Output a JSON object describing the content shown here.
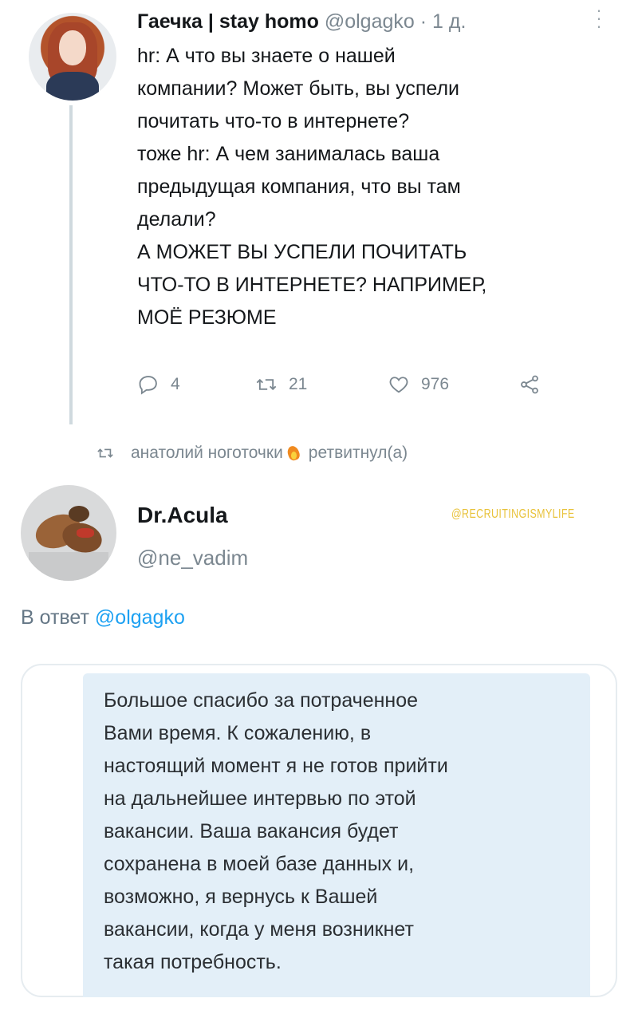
{
  "tweet1": {
    "display_name": "Гаечка | stay homo",
    "handle": "@olgagko",
    "dot": "·",
    "time": "1 д.",
    "body_lines": [
      "hr: А что вы знаете о нашей",
      "компании? Может быть, вы успели",
      "почитать что-то в интернете?",
      "тоже hr: А чем занималась ваша",
      "предыдущая компания, что вы там",
      "делали?",
      "А МОЖЕТ ВЫ УСПЕЛИ ПОЧИТАТЬ",
      "ЧТО-ТО В ИНТЕРНЕТЕ? НАПРИМЕР,",
      "МОЁ РЕЗЮМЕ"
    ],
    "reply_count": "4",
    "retweet_count": "21",
    "like_count": "976",
    "icons": [
      "reply-icon",
      "retweet-icon",
      "like-icon",
      "share-icon",
      "more-icon"
    ]
  },
  "retweet_notice": {
    "user": "анатолий ноготочки",
    "action": "ретвитнул(а)"
  },
  "tweet2": {
    "display_name": "Dr.Acula",
    "handle": "@ne_vadim",
    "watermark": "@RECRUITINGISMYLIFE",
    "reply_to_prefix": "В ответ",
    "reply_to_mention": "@olgagko",
    "quoted_message_lines": [
      "Большое спасибо за потраченное",
      "Вами время. К сожалению, в",
      "настоящий момент я не готов прийти",
      "на дальнейшее интервью по этой",
      "вакансии. Ваша вакансия будет",
      "сохранена в моей базе данных и,",
      "возможно, я вернусь к Вашей",
      "вакансии, когда у меня возникнет",
      "такая потребность."
    ]
  },
  "colors": {
    "link": "#1da1f2",
    "muted": "#7b8790",
    "bubble": "#e3eff8",
    "thread_line": "#cfd9de"
  }
}
